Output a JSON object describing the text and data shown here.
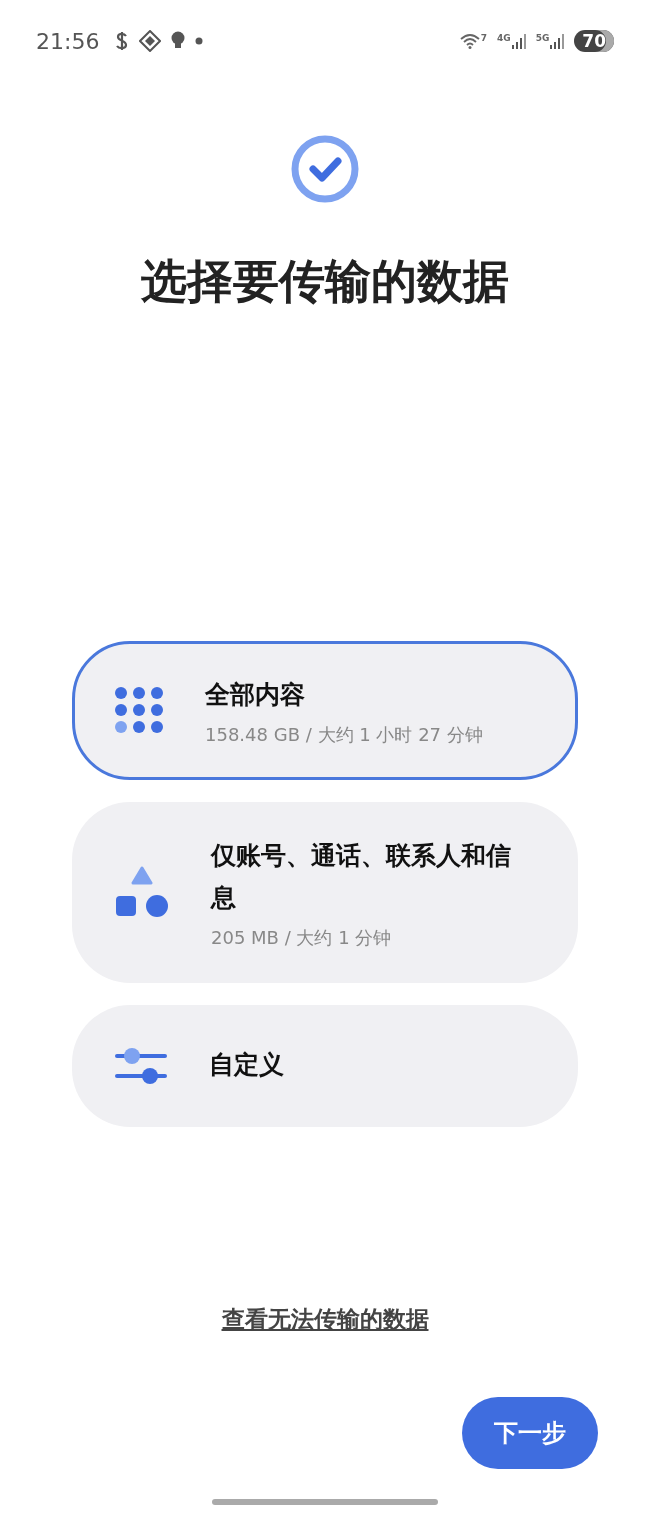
{
  "status_bar": {
    "time": "21:56",
    "wifi_label": "7",
    "networks": [
      "4G",
      "5G"
    ],
    "battery": "70"
  },
  "title": "选择要传输的数据",
  "options": [
    {
      "kind": "grid",
      "title": "全部内容",
      "detail": "158.48 GB / 大约 1 小时 27 分钟",
      "selected": true
    },
    {
      "kind": "shapes",
      "title": "仅账号、通话、联系人和信息",
      "detail": "205 MB / 大约 1 分钟",
      "selected": false
    },
    {
      "kind": "sliders",
      "title": "自定义",
      "selected": false
    }
  ],
  "link": "查看无法传输的数据",
  "next_button": "下一步"
}
